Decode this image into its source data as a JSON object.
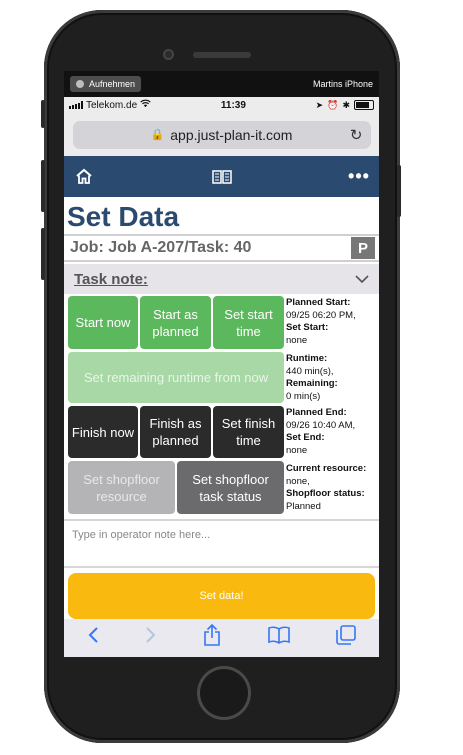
{
  "recording": {
    "label": "Aufnehmen",
    "device": "Martins iPhone"
  },
  "status_bar": {
    "carrier": "Telekom.de",
    "time": "11:39"
  },
  "browser": {
    "url": "app.just-plan-it.com"
  },
  "page": {
    "title": "Set Data",
    "job": "Job: Job A-207/Task: 40",
    "priority_badge": "P",
    "task_note_label": "Task note:"
  },
  "buttons": {
    "start_now": "Start now",
    "start_as_planned": "Start as planned",
    "set_start_time": "Set start time",
    "set_remaining_runtime": "Set remaining runtime from now",
    "finish_now": "Finish now",
    "finish_as_planned": "Finish as planned",
    "set_finish_time": "Set finish time",
    "set_shopfloor_resource": "Set shopfloor resource",
    "set_shopfloor_task_status": "Set shopfloor task status",
    "set_data": "Set data!"
  },
  "info": {
    "planned_start_label": "Planned Start:",
    "planned_start_value": "09/25 06:20 PM,",
    "set_start_label": "Set Start:",
    "set_start_value": "none",
    "runtime_label": "Runtime:",
    "runtime_value": "440 min(s),",
    "remaining_label": "Remaining:",
    "remaining_value": "0 min(s)",
    "planned_end_label": "Planned End:",
    "planned_end_value": "09/26 10:40 AM,",
    "set_end_label": "Set End:",
    "set_end_value": "none",
    "current_resource_label": "Current resource:",
    "current_resource_value": "none,",
    "shopfloor_status_label": "Shopfloor status:",
    "shopfloor_status_value": "Planned"
  },
  "operator_note": {
    "placeholder": "Type in operator note here..."
  },
  "icons": {
    "home": "home-icon",
    "book": "book-icon",
    "more": "more-icon",
    "back": "back-icon",
    "forward": "forward-icon",
    "share": "share-icon",
    "bookmarks": "bookmarks-icon",
    "tabs": "tabs-icon",
    "lock": "lock-icon",
    "reload": "reload-icon",
    "chevron": "chevron-down-icon"
  },
  "colors": {
    "navbar": "#2b4a6f",
    "green": "#5cb85c",
    "dark": "#2b2b2b",
    "set_data": "#f9b90f",
    "ios_blue": "#3478f6"
  }
}
